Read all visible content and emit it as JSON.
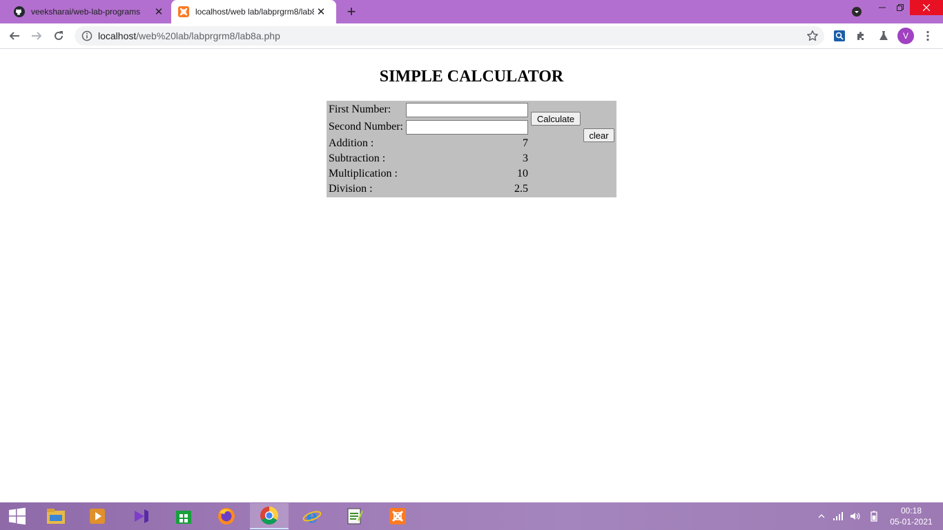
{
  "browser": {
    "tabs": [
      {
        "title": "veeksharai/web-lab-programs",
        "icon": "github-icon",
        "active": false
      },
      {
        "title": "localhost/web lab/labprgrm8/lab8a.php",
        "icon": "xampp-icon",
        "active": true
      }
    ],
    "url": {
      "host": "localhost",
      "path": "/web%20lab/labprgrm8/lab8a.php"
    },
    "profile_initial": "V",
    "accent_color": "#b36fcf"
  },
  "page": {
    "title": "SIMPLE CALCULATOR",
    "form": {
      "first_label": "First Number:",
      "first_value": "",
      "second_label": "Second Number:",
      "second_value": "",
      "calculate_label": "Calculate",
      "clear_label": "clear"
    },
    "results": [
      {
        "label": "Addition :",
        "value": "7"
      },
      {
        "label": "Subtraction :",
        "value": "3"
      },
      {
        "label": "Multiplication :",
        "value": "10"
      },
      {
        "label": "Division :",
        "value": "2.5"
      }
    ],
    "panel_color": "#bfbfbf"
  },
  "taskbar": {
    "apps": [
      "file-explorer-icon",
      "video-player-icon",
      "visual-studio-icon",
      "store-icon",
      "firefox-icon",
      "chrome-icon",
      "internet-explorer-icon",
      "notepad-plus-icon",
      "xampp-icon"
    ],
    "time": "00:18",
    "date": "05-01-2021"
  }
}
